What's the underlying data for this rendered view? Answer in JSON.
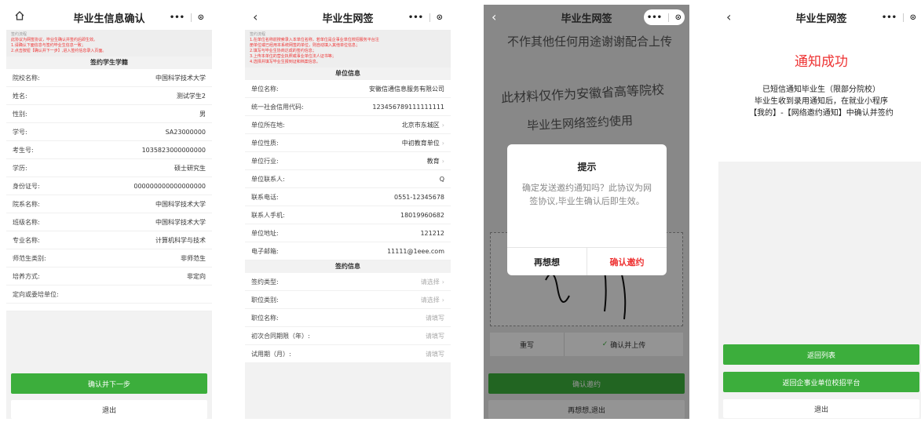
{
  "phone1": {
    "title": "毕业生信息确认",
    "tips_title": "签约流程",
    "tips": [
      "此协议为网签协议，毕业生确认并签约后即生效。",
      "1.请确认下面信息与签约毕业生信息一致；",
      "2.点击按钮【确认并下一步】,进入签约信息录入页面。"
    ],
    "section": "签约学生学籍",
    "rows": [
      {
        "label": "院校名称:",
        "value": "中国科学技术大学"
      },
      {
        "label": "姓名:",
        "value": "测试学生2"
      },
      {
        "label": "性别:",
        "value": "男"
      },
      {
        "label": "学号:",
        "value": "SA23000000"
      },
      {
        "label": "考生号:",
        "value": "1035823000000000"
      },
      {
        "label": "学历:",
        "value": "硕士研究生"
      },
      {
        "label": "身份证号:",
        "value": "000000000000000000"
      },
      {
        "label": "院系名称:",
        "value": "中国科学技术大学"
      },
      {
        "label": "班级名称:",
        "value": "中国科学技术大学"
      },
      {
        "label": "专业名称:",
        "value": "计算机科学与技术"
      },
      {
        "label": "师范生类别:",
        "value": "非师范生"
      },
      {
        "label": "培养方式:",
        "value": "非定向"
      },
      {
        "label": "定向或委培单位:",
        "value": ""
      }
    ],
    "btn_primary": "确认并下一步",
    "btn_secondary": "退出"
  },
  "phone2": {
    "title": "毕业生网签",
    "tips_title": "签约流程",
    "tips": [
      "1.在单位名称前搜索录入本单位名称，若单位是企事业单位校招服务平台注",
      "册单位或已经用本系统网签的单位，则自动填入其他单位信息；",
      "2.填写与毕业生协商达成的签约信息；",
      "3.上传本单位的营业执照或事业单位法人证书等；",
      "4.选择并填写毕业生报到证和档案信息。"
    ],
    "section_unit": "单位信息",
    "unit_rows": [
      {
        "label": "单位名称:",
        "value": "安徽信通信息服务有限公司",
        "arrow": false,
        "ph": false
      },
      {
        "label": "统一社会信用代码:",
        "value": "123456789111111111",
        "arrow": false,
        "ph": false
      },
      {
        "label": "单位所在地:",
        "value": "北京市东城区",
        "arrow": true,
        "ph": false
      },
      {
        "label": "单位性质:",
        "value": "中初教育单位",
        "arrow": true,
        "ph": false
      },
      {
        "label": "单位行业:",
        "value": "教育",
        "arrow": true,
        "ph": false
      },
      {
        "label": "单位联系人:",
        "value": "Q",
        "arrow": false,
        "ph": false
      },
      {
        "label": "联系电话:",
        "value": "0551-12345678",
        "arrow": false,
        "ph": false
      },
      {
        "label": "联系人手机:",
        "value": "18019960682",
        "arrow": false,
        "ph": false
      },
      {
        "label": "单位地址:",
        "value": "121212",
        "arrow": false,
        "ph": false
      },
      {
        "label": "电子邮箱:",
        "value": "11111@1eee.com",
        "arrow": false,
        "ph": false
      }
    ],
    "section_sign": "签约信息",
    "sign_rows": [
      {
        "label": "签约类型:",
        "value": "请选择",
        "arrow": true,
        "ph": true
      },
      {
        "label": "职位类别:",
        "value": "请选择",
        "arrow": true,
        "ph": true
      },
      {
        "label": "职位名称:",
        "value": "请填写",
        "arrow": false,
        "ph": true
      },
      {
        "label": "初次合同期限（年）:",
        "value": "请填写",
        "arrow": false,
        "ph": true
      },
      {
        "label": "试用期（月）:",
        "value": "请填写",
        "arrow": false,
        "ph": true
      }
    ]
  },
  "phone3": {
    "title": "毕业生网签",
    "watermark": [
      "不作其他任何用途谢谢配合上传",
      "此材料仅作为安徽省高等院校",
      "毕业生网络签约使用"
    ],
    "dialog_title": "提示",
    "dialog_text": "确定发送邀约通知吗？此协议为网签协议,毕业生确认后即生效。",
    "dialog_cancel": "再想想",
    "dialog_ok": "确认邀约",
    "rewrite": "重写",
    "confirm_upload": "确认并上传",
    "btn_invite": "确认邀约",
    "btn_back": "再想想,退出"
  },
  "phone4": {
    "title": "毕业生网签",
    "success": "通知成功",
    "msg_line1": "已短信通知毕业生（限部分院校）",
    "msg_line2": "毕业生收到录用通知后，在就业小程序",
    "msg_line3": "【我的】-【网络邀约通知】中确认并签约",
    "btn_list": "返回列表",
    "btn_platform": "返回企事业单位校招平台",
    "btn_exit": "退出"
  },
  "colors": {
    "green": "#3cae3c",
    "red": "#e33333"
  },
  "icons": {
    "home": "home-icon",
    "back": "chevron-left-icon",
    "more": "more-dots-icon",
    "target": "target-icon",
    "check": "check-icon"
  }
}
